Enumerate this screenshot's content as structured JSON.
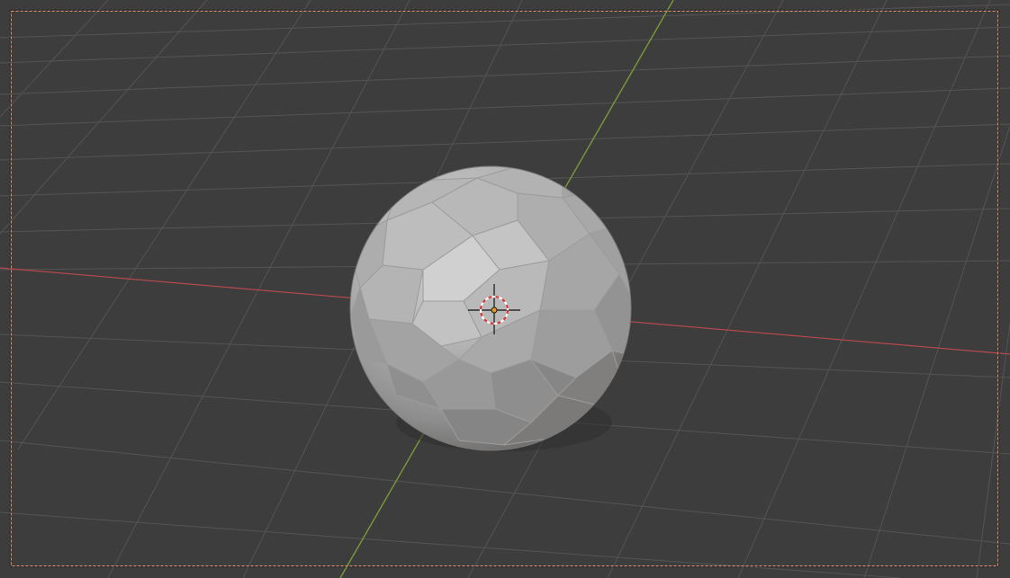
{
  "viewport": {
    "background_color": "#3d3d3d",
    "grid_color": "#545454",
    "x_axis_color": "#b8494f",
    "y_axis_color": "#7a9a38",
    "camera_frame_color": "#e08a6a"
  },
  "object": {
    "type": "icosphere",
    "base_color": "#b4b4b4",
    "origin_color": "#e89a1e"
  },
  "cursor": {
    "name": "3d-cursor",
    "ring_colors": [
      "#d63a3a",
      "#ffffff"
    ]
  }
}
